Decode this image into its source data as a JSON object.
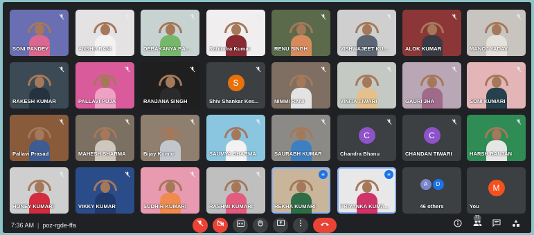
{
  "participants": [
    {
      "name": "SONI PANDEY",
      "bg": "#6a6fb3",
      "shirt": "#d9678f"
    },
    {
      "name": "ANSHU RANI",
      "bg": "#e5e2e4",
      "shirt": "#f2f2f2"
    },
    {
      "name": "DEBAKANYA BA...",
      "bg": "#c7d3d1",
      "shirt": "#76b86a"
    },
    {
      "name": "Rabindra Kumar",
      "bg": "#f0eeee",
      "shirt": "#8a2a33"
    },
    {
      "name": "RENU SINGH",
      "bg": "#5a6a4b",
      "shirt": "#d78b5b"
    },
    {
      "name": "VISHWAJEET KU...",
      "bg": "#cfcfcf",
      "shirt": "#5c6674"
    },
    {
      "name": "ALOK KUMAR",
      "bg": "#8c3637",
      "shirt": "#3a3a45"
    },
    {
      "name": "MANOJ YADAV",
      "bg": "#c8c4c0",
      "shirt": "#e4e0da"
    },
    {
      "name": "RAKESH KUMAR",
      "bg": "#3b4a55",
      "shirt": "#253240"
    },
    {
      "name": "PALLAVI PUJA",
      "bg": "#d95b9b",
      "shirt": "#f0a0c4"
    },
    {
      "name": "RANJANA SINGH",
      "bg": "#1f1f1f",
      "shirt": "#2b2b2b"
    },
    {
      "name": "Shiv Shankar Kes...",
      "avatar": "S",
      "avatar_color": "#e8710a"
    },
    {
      "name": "NIMMI RANI",
      "bg": "#7f6f62",
      "shirt": "#e3e3e3"
    },
    {
      "name": "VINITA TIWARI",
      "bg": "#c5c9c4",
      "shirt": "#e4c08c"
    },
    {
      "name": "GAURI JHA",
      "bg": "#b9a7b5",
      "shirt": "#a06a8a"
    },
    {
      "name": "SONI KUMARI",
      "bg": "#e4b5b7",
      "shirt": "#26404d"
    },
    {
      "name": "Pallavi Prasad",
      "bg": "#8a5b3a",
      "shirt": "#3e5c93"
    },
    {
      "name": "MAHESH SHARMA",
      "bg": "#7b7062",
      "shirt": "#cfc7bd"
    },
    {
      "name": "Bijay Kumar",
      "bg": "#8f7f6f",
      "shirt": "#c3c6cc"
    },
    {
      "name": "SAUMYA SHARMA",
      "bg": "#8ac6e0",
      "shirt": "#f2f2f2"
    },
    {
      "name": "SAURABH KUMAR",
      "bg": "#8c8a86",
      "shirt": "#3e7fc2"
    },
    {
      "name": "Chandra Bhanu",
      "avatar": "C",
      "avatar_color": "#8e52c9"
    },
    {
      "name": "CHANDAN TIWARI",
      "avatar": "C",
      "avatar_color": "#8e52c9"
    },
    {
      "name": "HARSH RANJAN",
      "bg": "#2e8c54",
      "shirt": "#e6e6e6"
    },
    {
      "name": "HONEY KUMARI",
      "bg": "#cfcfcf",
      "shirt": "#d22c3e"
    },
    {
      "name": "VIKKY KUMAR",
      "bg": "#2a4d8a",
      "shirt": "#203a6d"
    },
    {
      "name": "SUDHIR KUMARI",
      "bg": "#e89ab0",
      "shirt": "#f08a4e"
    },
    {
      "name": "RASHMI KUMARI",
      "bg": "#bfbfbf",
      "shirt": "#e35c7f"
    },
    {
      "name": "REKHA KUMARI",
      "bg": "#c9b69a",
      "shirt": "#2f6d46",
      "speaking": true
    },
    {
      "name": "PRIYANKA KUMA...",
      "bg": "#e8e8e8",
      "shirt": "#d0336a",
      "speaking": true
    },
    {
      "name": "46 others",
      "others": [
        "A",
        "D"
      ],
      "others_colors": [
        "#7986cb",
        "#1a73e8"
      ]
    },
    {
      "name": "You",
      "avatar": "M",
      "avatar_color": "#f4511e"
    }
  ],
  "bottombar": {
    "time": "7:36 AM",
    "meeting_code": "poz-rgde-ffa",
    "people_count": "77"
  },
  "icons": {
    "muted": "mic-off-icon",
    "speaking": "audio-level-icon"
  }
}
